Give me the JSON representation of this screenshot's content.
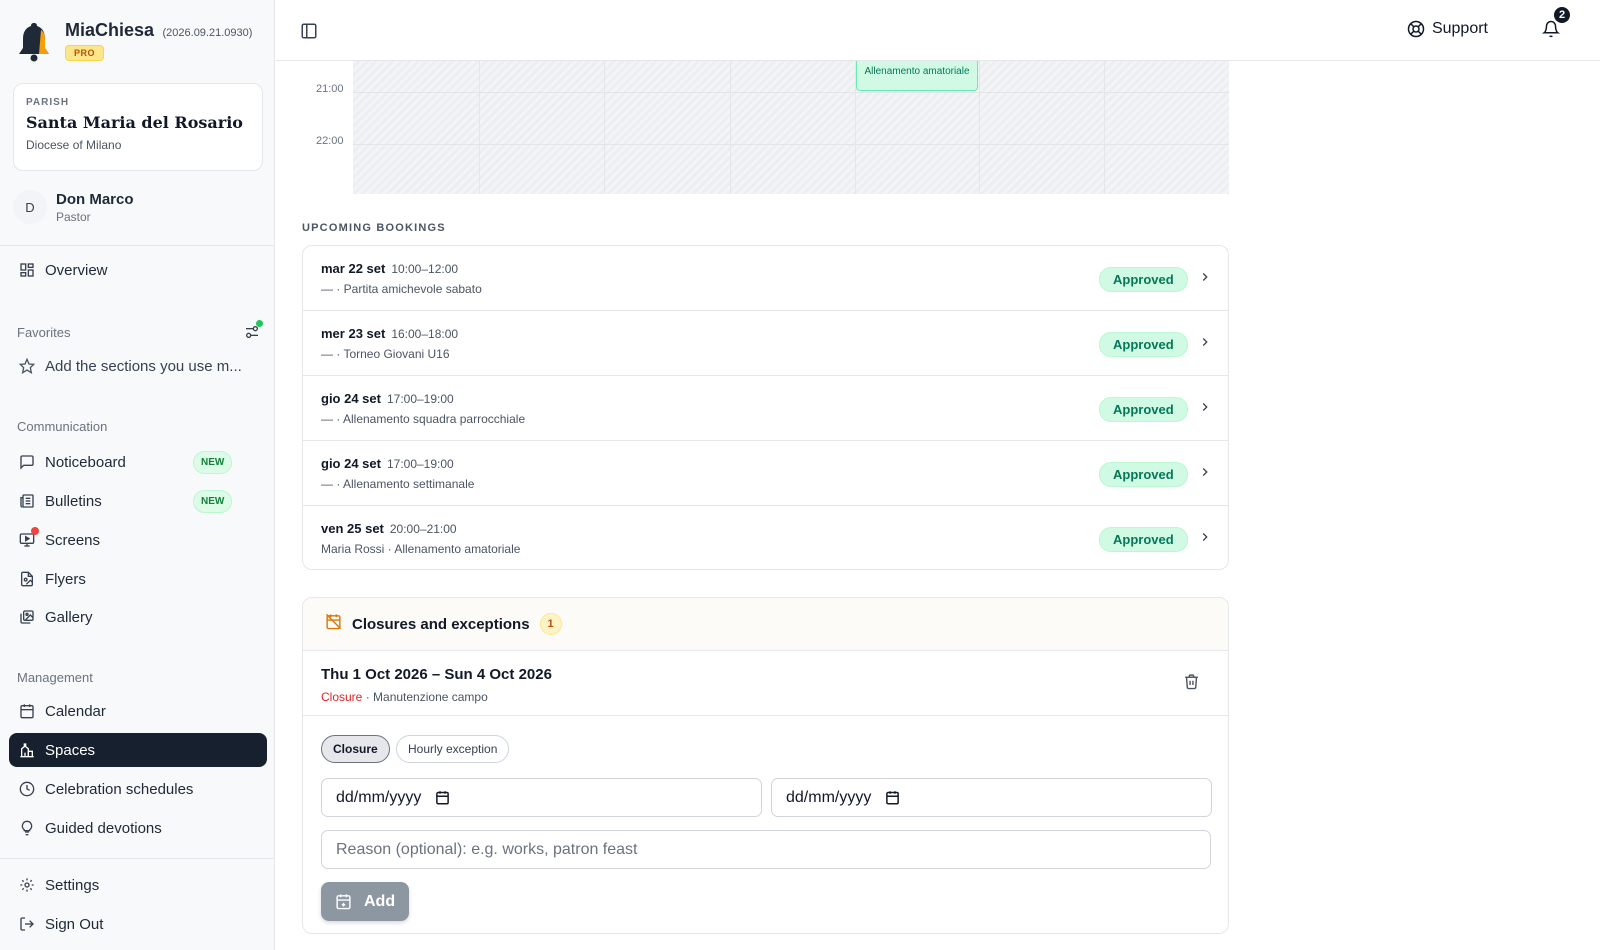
{
  "brand": {
    "name": "MiaChiesa",
    "version": "(2026.09.21.0930)",
    "plan": "PRO"
  },
  "parish": {
    "label": "PARISH",
    "name": "Santa Maria del Rosario",
    "diocese": "Diocese of Milano"
  },
  "user": {
    "initial": "D",
    "name": "Don Marco",
    "role": "Pastor"
  },
  "nav": {
    "overview": "Overview",
    "favorites_label": "Favorites",
    "favorites_hint": "Add the sections you use m...",
    "communication_label": "Communication",
    "noticeboard": "Noticeboard",
    "bulletins": "Bulletins",
    "screens": "Screens",
    "flyers": "Flyers",
    "gallery": "Gallery",
    "new_badge": "NEW",
    "management_label": "Management",
    "calendar": "Calendar",
    "spaces": "Spaces",
    "celebration_schedules": "Celebration schedules",
    "guided_devotions": "Guided devotions",
    "settings": "Settings",
    "sign_out": "Sign Out"
  },
  "topbar": {
    "support": "Support",
    "notifications_count": "2"
  },
  "calendar": {
    "time_labels": [
      "21:00",
      "22:00"
    ],
    "event_text": "Allenamento amatoriale"
  },
  "bookings": {
    "heading": "UPCOMING BOOKINGS",
    "items": [
      {
        "date": "mar 22 set",
        "time": "10:00–12:00",
        "desc": "— · Partita amichevole sabato",
        "status": "Approved"
      },
      {
        "date": "mer 23 set",
        "time": "16:00–18:00",
        "desc": "— · Torneo Giovani U16",
        "status": "Approved"
      },
      {
        "date": "gio 24 set",
        "time": "17:00–19:00",
        "desc": "— · Allenamento squadra parrocchiale",
        "status": "Approved"
      },
      {
        "date": "gio 24 set",
        "time": "17:00–19:00",
        "desc": "— · Allenamento settimanale",
        "status": "Approved"
      },
      {
        "date": "ven 25 set",
        "time": "20:00–21:00",
        "desc": "Maria Rossi · Allenamento amatoriale",
        "status": "Approved"
      }
    ]
  },
  "closures": {
    "title": "Closures and exceptions",
    "count": "1",
    "item": {
      "range": "Thu 1 Oct 2026 – Sun 4 Oct 2026",
      "type": "Closure",
      "reason": " · Manutenzione campo"
    },
    "tab_closure": "Closure",
    "tab_hourly": "Hourly exception",
    "date_placeholder": "dd/mm/yyyy",
    "reason_placeholder": "Reason (optional): e.g. works, patron feast",
    "add_label": "Add"
  },
  "colors": {
    "active_nav": "#16202e",
    "approved_bg": "#d1fae5",
    "approved_text": "#047857",
    "closure_red": "#dc2626"
  }
}
